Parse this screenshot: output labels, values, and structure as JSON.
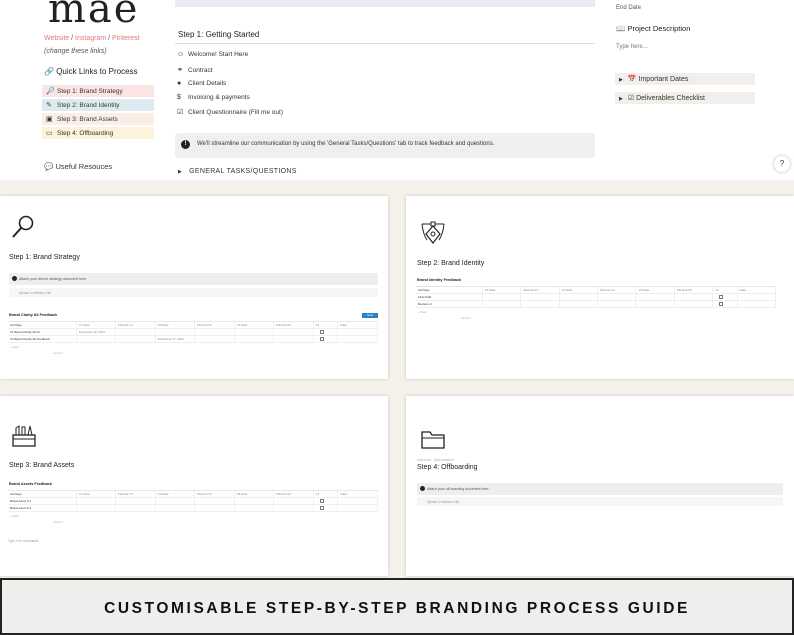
{
  "sidebar": {
    "logo": "mae",
    "site_links": [
      "Website",
      "Instagram",
      "Pinterest"
    ],
    "site_link_sep": "/",
    "change_links": "(change these links)",
    "quick_links_title": "Quick Links to Process",
    "quick_links": [
      {
        "label": "Step 1: Brand Strategy",
        "icon": "magnifier-icon",
        "color": "#fbe4e4"
      },
      {
        "label": "Step 2: Brand Identity",
        "icon": "pen-tool-icon",
        "color": "#ddebf1"
      },
      {
        "label": "Step 3: Brand Assets",
        "icon": "toolbox-icon",
        "color": "#fbeee6"
      },
      {
        "label": "Step 4: Offboarding",
        "icon": "folder-icon",
        "color": "#fbf3db"
      }
    ],
    "useful_resources": "Useful Resouces"
  },
  "main": {
    "step_title": "Step 1: Getting Started",
    "nav_items": [
      {
        "label": "Welcome! Start Here",
        "icon": "smile-icon"
      },
      {
        "label": "Contract",
        "icon": "handshake-icon"
      },
      {
        "label": "Client Details",
        "icon": "person-icon"
      },
      {
        "label": "Invoicing & payments",
        "icon": "dollar-icon"
      },
      {
        "label": "Client Questionnaire (Fill me out)",
        "icon": "checklist-icon"
      }
    ],
    "callout": "We'll streamline our communication by using the 'General Tasks/Questions' tab to track feedback and questions.",
    "toggle": "GENERAL TASKS/QUESTIONS"
  },
  "right": {
    "end_date": "End Date",
    "project_description": "Project Description",
    "type_here": "Type here...",
    "toggles": [
      {
        "label": "Important Dates",
        "icon": "calendar-icon"
      },
      {
        "label": "Deliverables Checklist",
        "icon": "checkbox-icon"
      }
    ],
    "help": "?"
  },
  "cards": {
    "c1": {
      "title": "Step 1: Brand Strategy",
      "callout": "Attach your client's strategy document here.",
      "upload": "Upload or embed a file",
      "db_title": "Brand Clarity All Feedback",
      "db_action": "+ Add a item",
      "search": "Search",
      "new": "New",
      "headers": [
        "Aa Page",
        "V1 Date",
        "FileLink V1",
        "V2 Date",
        "FileLink V2",
        "V3 Date",
        "FileLink V3",
        "V1",
        "Date"
      ],
      "rows": [
        [
          "V1 Brand Clarity All Fe",
          "December 10, 2021",
          "",
          "",
          "",
          "",
          "",
          "",
          ""
        ],
        [
          "V2 Brand Clarity All Feedback",
          "",
          "",
          "December 27, 2021",
          "",
          "",
          "",
          "",
          ""
        ]
      ],
      "add_new": "+ New",
      "count": "count 2"
    },
    "c2": {
      "title": "Step 2: Brand Identity",
      "db_title": "Brand Identity Feedback",
      "headers": [
        "Aa Page",
        "V1 Date",
        "FileLink V1",
        "V2 Date",
        "FileLink V2",
        "V3 Date",
        "FileLink V3",
        "V1",
        "Date"
      ],
      "rows": [
        [
          "First Draft",
          "",
          "",
          "",
          "",
          "",
          "",
          "",
          ""
        ],
        [
          "Revision 1",
          "",
          "",
          "",
          "",
          "",
          "",
          "",
          ""
        ]
      ],
      "add_new": "+ New",
      "count": "count 2"
    },
    "c3": {
      "title": "Step 3: Brand Assets",
      "db_title": "Brand Assets Feedback",
      "headers": [
        "Aa Page",
        "V1 Date",
        "FileLink V1",
        "V2 Date",
        "FileLink V2",
        "V3 Date",
        "FileLink V3",
        "V1",
        "Date"
      ],
      "rows": [
        [
          "Brand Asset # 1",
          "",
          "",
          "",
          "",
          "",
          "",
          "",
          ""
        ],
        [
          "Brand Asset # 2",
          "",
          "",
          "",
          "",
          "",
          "",
          "",
          ""
        ]
      ],
      "add_new": "+ New",
      "count": "count 2",
      "comments": "Type // for commands"
    },
    "c4": {
      "title": "Step 4: Offboarding",
      "meta": [
        "Add cover",
        "Add comment"
      ],
      "callout": "Attach your off boarding document here.",
      "upload": "Upload or embed a file"
    }
  },
  "banner": {
    "text": "CUSTOMISABLE STEP-BY-STEP BRANDING PROCESS GUIDE"
  }
}
